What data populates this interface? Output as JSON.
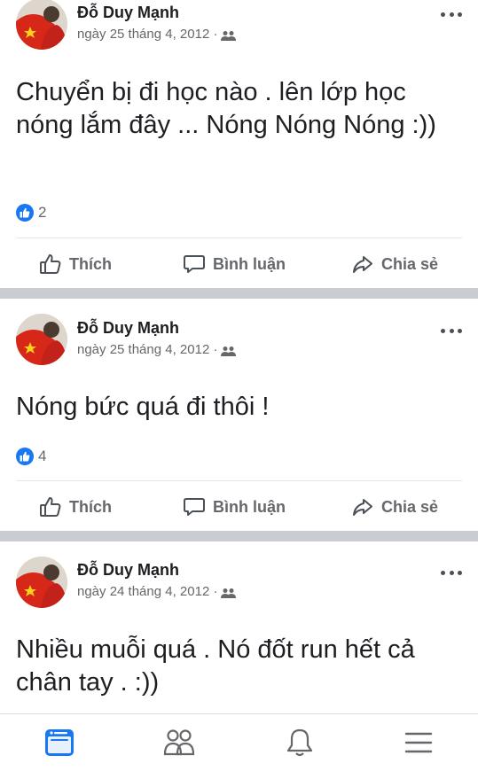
{
  "posts": [
    {
      "author": "Đỗ Duy Mạnh",
      "date": "ngày 25 tháng 4, 2012 ·",
      "text": "Chuyển bị đi học nào . lên lớp học nóng lắm đây ... Nóng Nóng Nóng :))",
      "like_count": "2"
    },
    {
      "author": "Đỗ Duy Mạnh",
      "date": "ngày 25 tháng 4, 2012 ·",
      "text": "Nóng bức quá đi thôi !",
      "like_count": "4"
    },
    {
      "author": "Đỗ Duy Mạnh",
      "date": "ngày 24 tháng 4, 2012 ·",
      "text": "Nhiều muỗi quá . Nó đốt run hết cả chân tay . :))"
    }
  ],
  "actions": {
    "like_label": "Thích",
    "comment_label": "Bình luận",
    "share_label": "Chia sẻ"
  },
  "icons": {
    "audience": "friends-icon",
    "like": "thumbs-up-icon",
    "comment": "speech-bubble-icon",
    "share": "share-arrow-icon",
    "more": "more-dots-icon"
  },
  "bottom_nav": [
    "news-feed-icon",
    "friends-icon",
    "notifications-bell-icon",
    "menu-icon"
  ],
  "colors": {
    "accent": "#1877f2",
    "secondary_text": "#65676b",
    "separator": "#c9ccd1"
  }
}
